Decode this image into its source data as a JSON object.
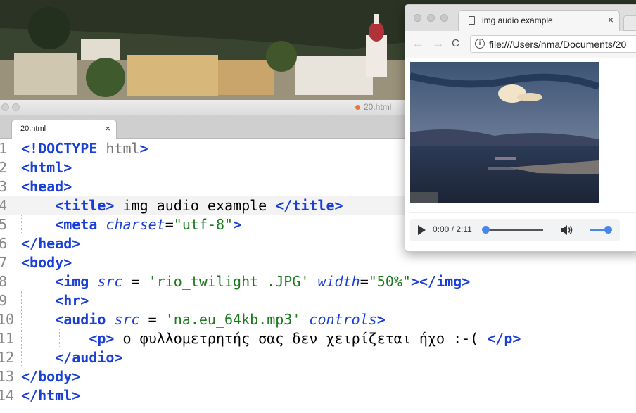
{
  "editor": {
    "window_title": "20.html",
    "tab_label": "20.html",
    "tab_close": "×",
    "lines": [
      {
        "num": "1",
        "html": "<span class='k'>&lt;!DOCTYPE</span> <span class='g'>html</span><span class='k'>&gt;</span>"
      },
      {
        "num": "2",
        "html": "<span class='k'>&lt;html&gt;</span>"
      },
      {
        "num": "3",
        "html": "<span class='k'>&lt;head&gt;</span>"
      },
      {
        "num": "4",
        "html": "    <span class='k'>&lt;title&gt;</span> img audio example <span class='k'>&lt;/title&gt;</span>"
      },
      {
        "num": "5",
        "html": "    <span class='k'>&lt;meta</span> <span class='a'>charset</span>=<span class='s'>\"utf-8\"</span><span class='k'>&gt;</span>"
      },
      {
        "num": "6",
        "html": "<span class='k'>&lt;/head&gt;</span>"
      },
      {
        "num": "7",
        "html": "<span class='k'>&lt;body&gt;</span>"
      },
      {
        "num": "8",
        "html": "    <span class='k'>&lt;img</span> <span class='a'>src</span> = <span class='s'>'rio_twilight .JPG'</span> <span class='a'>width</span>=<span class='s'>\"50%\"</span><span class='k'>&gt;&lt;/img&gt;</span>"
      },
      {
        "num": "9",
        "html": "    <span class='k'>&lt;hr&gt;</span>"
      },
      {
        "num": "10",
        "html": "    <span class='k'>&lt;audio</span> <span class='a'>src</span> = <span class='s'>'na.eu_64kb.mp3'</span> <span class='a'>controls</span><span class='k'>&gt;</span>"
      },
      {
        "num": "11",
        "html": "        <span class='k'>&lt;p&gt;</span> ο φυλλομετρητής σας δεν χειρίζεται ήχο :-( <span class='k'>&lt;/p&gt;</span>"
      },
      {
        "num": "12",
        "html": "    <span class='k'>&lt;/audio&gt;</span>"
      },
      {
        "num": "13",
        "html": "<span class='k'>&lt;/body&gt;</span>"
      },
      {
        "num": "14",
        "html": "<span class='k'>&lt;/html&gt;</span>"
      }
    ]
  },
  "browser": {
    "tab_title": "img audio example",
    "tab_close": "×",
    "back_icon": "←",
    "forward_icon": "→",
    "reload_icon": "C",
    "info_icon": "i",
    "url": "file:///Users/nma/Documents/20",
    "player": {
      "time": "0:00 / 2:11",
      "progress": 0,
      "volume": 1.0
    }
  }
}
